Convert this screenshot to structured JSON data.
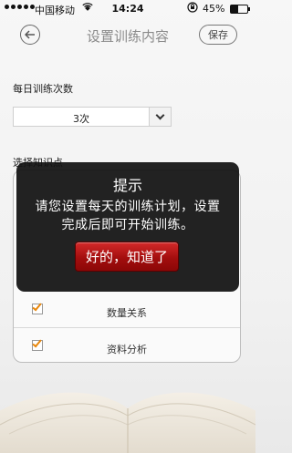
{
  "status_bar": {
    "carrier": "中国移动",
    "time": "14:24",
    "battery_percent": "45%",
    "battery_level": 0.45,
    "icons": [
      "signal-dots-icon",
      "wifi-icon",
      "rotation-lock-icon",
      "battery-icon"
    ]
  },
  "nav": {
    "back_icon": "back-arrow-icon",
    "title": "设置训练内容",
    "save_label": "保存"
  },
  "daily": {
    "label": "每日训练次数",
    "selected": "3次"
  },
  "modules": {
    "label": "选择知识点",
    "items": [
      {
        "label": "数量关系",
        "checked": true
      },
      {
        "label": "资料分析",
        "checked": true
      }
    ]
  },
  "modal": {
    "title": "提示",
    "body_line1": "请您设置每天的训练计划，设置",
    "body_line2": "完成后即可开始训练。",
    "confirm_label": "好的，知道了"
  },
  "colors": {
    "accent_orange": "#e8860a",
    "modal_bg": "#111111",
    "button_red": "#b31414"
  }
}
